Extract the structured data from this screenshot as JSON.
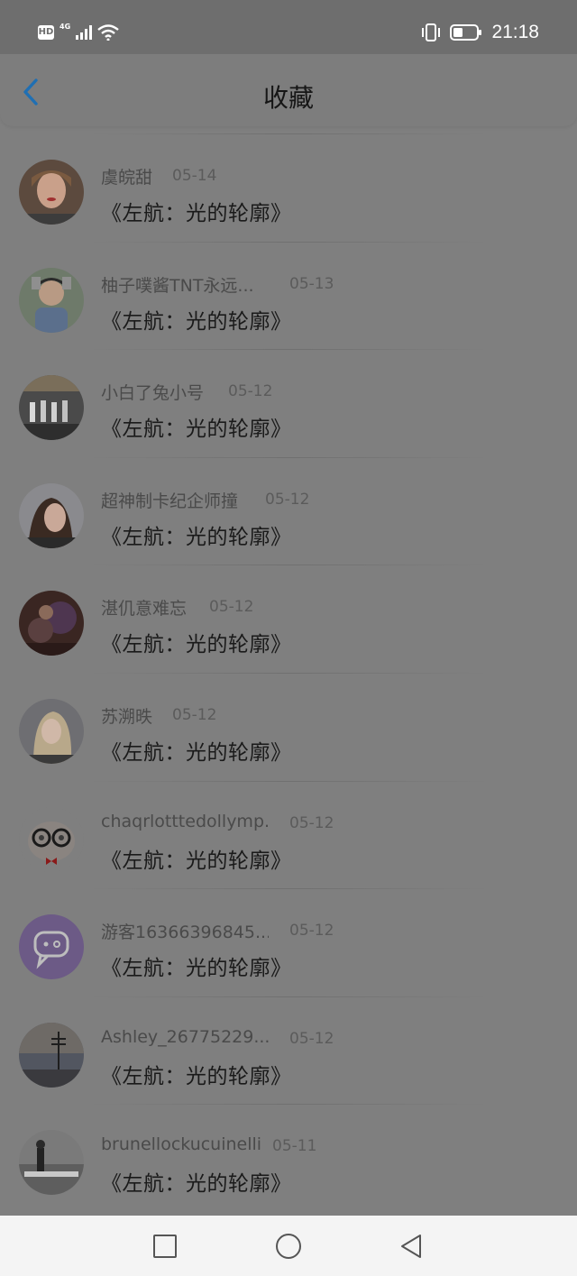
{
  "status_bar": {
    "hd": "HD",
    "network": "4G",
    "time": "21:18",
    "icons": [
      "signal-icon",
      "wifi-icon",
      "vibrate-icon",
      "battery-icon"
    ]
  },
  "header": {
    "title": "收藏",
    "back_icon": "chevron-left-icon",
    "accent": "#1f6fb3"
  },
  "items": [
    {
      "username": "虞皖甜",
      "date": "05-14",
      "title": "《左航：光的轮廓》"
    },
    {
      "username": "柚子噗酱TNT永远...",
      "date": "05-13",
      "title": "《左航：光的轮廓》"
    },
    {
      "username": "小白了兔小号",
      "date": "05-12",
      "title": "《左航：光的轮廓》"
    },
    {
      "username": "超神制卡纪企师撞",
      "date": "05-12",
      "title": "《左航：光的轮廓》"
    },
    {
      "username": "湛仉意难忘",
      "date": "05-12",
      "title": "《左航：光的轮廓》"
    },
    {
      "username": "苏溯昳",
      "date": "05-12",
      "title": "《左航：光的轮廓》"
    },
    {
      "username": "chaqrlotttedollymp...",
      "date": "05-12",
      "title": "《左航：光的轮廓》"
    },
    {
      "username": "游客16366396845...",
      "date": "05-12",
      "title": "《左航：光的轮廓》"
    },
    {
      "username": "Ashley_26775229...",
      "date": "05-12",
      "title": "《左航：光的轮廓》"
    },
    {
      "username": "brunellockucuinelli",
      "date": "05-11",
      "title": "《左航：光的轮廓》"
    }
  ],
  "nav_bar": {
    "icons": [
      "recents-square-icon",
      "home-circle-icon",
      "back-triangle-icon"
    ]
  }
}
